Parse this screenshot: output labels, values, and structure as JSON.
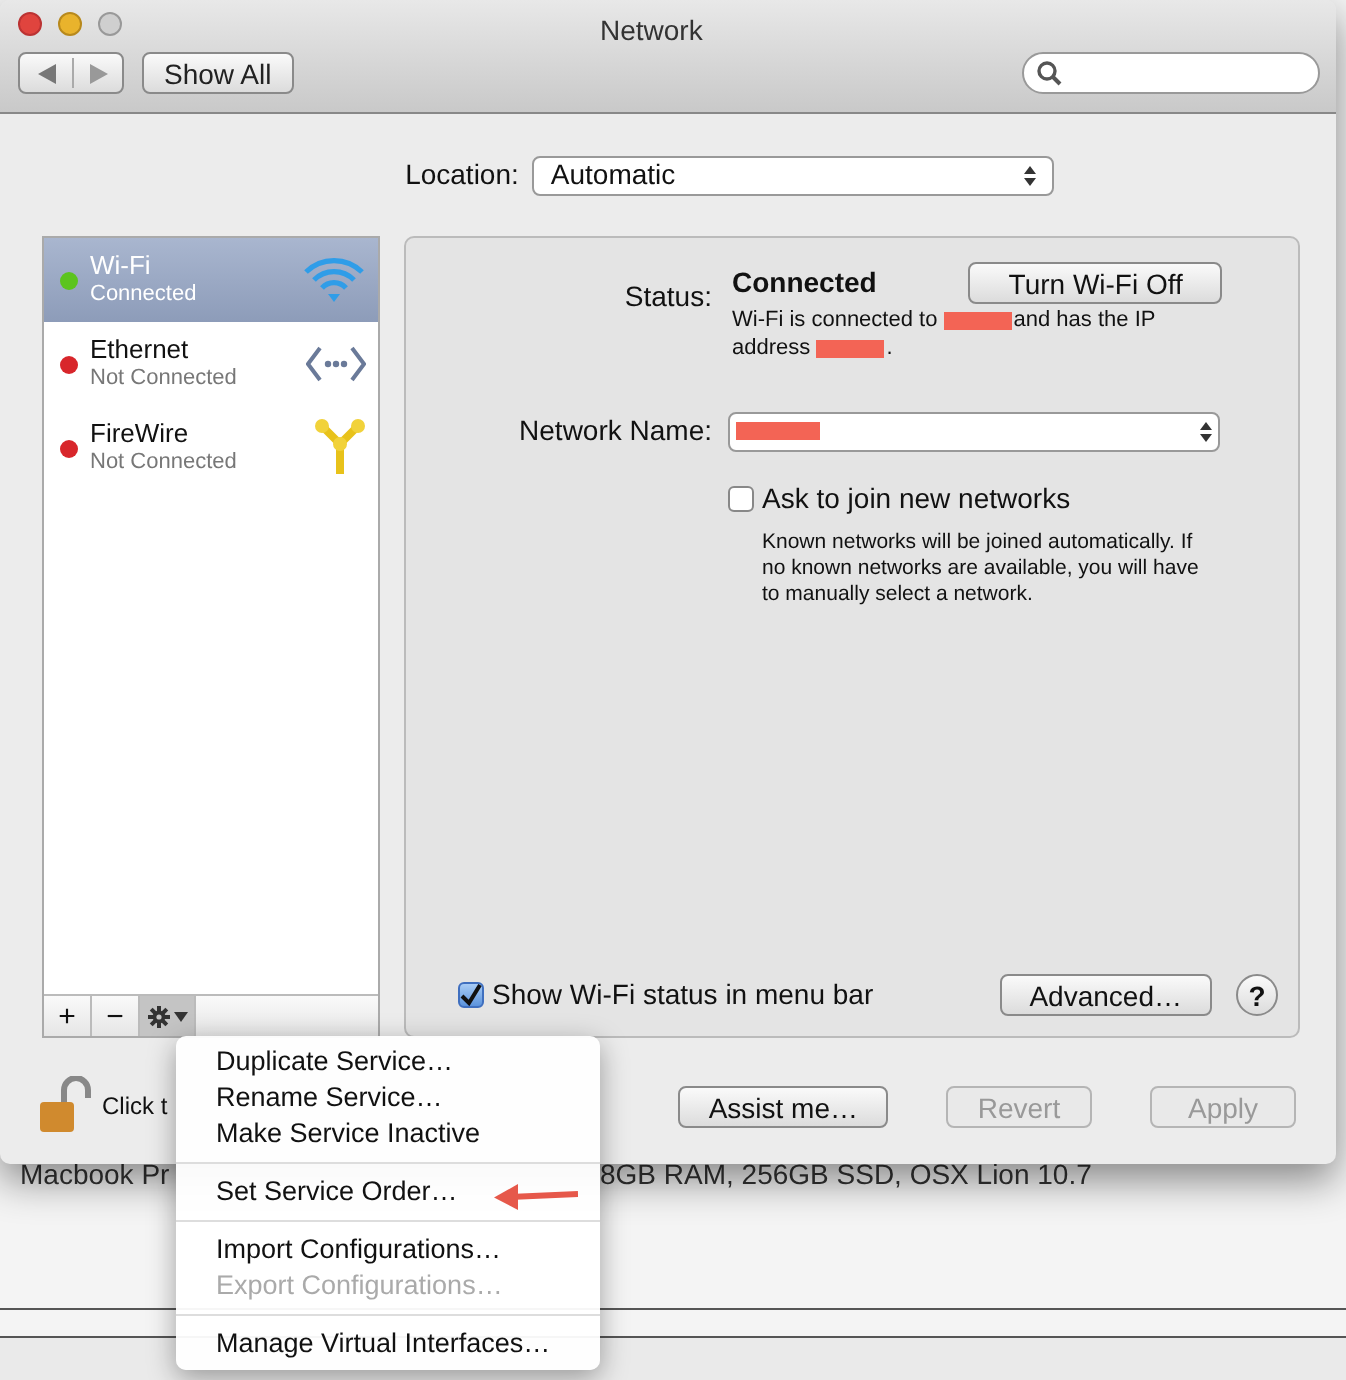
{
  "window": {
    "title": "Network",
    "show_all": "Show All"
  },
  "location": {
    "label": "Location:",
    "value": "Automatic"
  },
  "services": [
    {
      "name": "Wi-Fi",
      "status": "Connected",
      "selected": true,
      "color": "#5cc41f",
      "kind": "wifi"
    },
    {
      "name": "Ethernet",
      "status": "Not Connected",
      "selected": false,
      "color": "#d8262b",
      "kind": "ethernet"
    },
    {
      "name": "FireWire",
      "status": "Not Connected",
      "selected": false,
      "color": "#d8262b",
      "kind": "firewire"
    }
  ],
  "list_buttons": [
    "+",
    "−"
  ],
  "detail": {
    "status_label": "Status:",
    "status_value": "Connected",
    "toggle_button": "Turn Wi-Fi Off",
    "status_text": [
      {
        "kind": "text",
        "text": "Wi-Fi is connected to"
      },
      {
        "kind": "redaction"
      },
      {
        "kind": "text",
        "text": "and has the IP address"
      },
      {
        "kind": "redaction"
      },
      {
        "kind": "text",
        "text": "."
      }
    ],
    "network_name_label": "Network Name:",
    "ask_to_join": {
      "label": "Ask to join new networks",
      "checked": false
    },
    "ask_note": "Known networks will be joined automatically. If no known networks are available, you will have to manually select a network.",
    "show_status": {
      "label": "Show Wi-Fi status in menu bar",
      "checked": true
    },
    "advanced_button": "Advanced…",
    "help_button": "?"
  },
  "lock_label": "Click t",
  "buttons": [
    {
      "label": "Assist me…",
      "disabled": false
    },
    {
      "label": "Revert",
      "disabled": true
    },
    {
      "label": "Apply",
      "disabled": true
    }
  ],
  "background_text": [
    "Macbook Pr",
    "8GB RAM, 256GB SSD, OSX Lion 10.7"
  ],
  "menu": [
    {
      "label": "Duplicate Service…",
      "disabled": false,
      "separator_before": false
    },
    {
      "label": "Rename Service…",
      "disabled": false,
      "separator_before": false
    },
    {
      "label": "Make Service Inactive",
      "disabled": false,
      "separator_before": false
    },
    {
      "label": "Set Service Order…",
      "disabled": false,
      "separator_before": true
    },
    {
      "label": "Import Configurations…",
      "disabled": false,
      "separator_before": true
    },
    {
      "label": "Export Configurations…",
      "disabled": true,
      "separator_before": false
    },
    {
      "label": "Manage Virtual Interfaces…",
      "disabled": false,
      "separator_before": true
    }
  ]
}
